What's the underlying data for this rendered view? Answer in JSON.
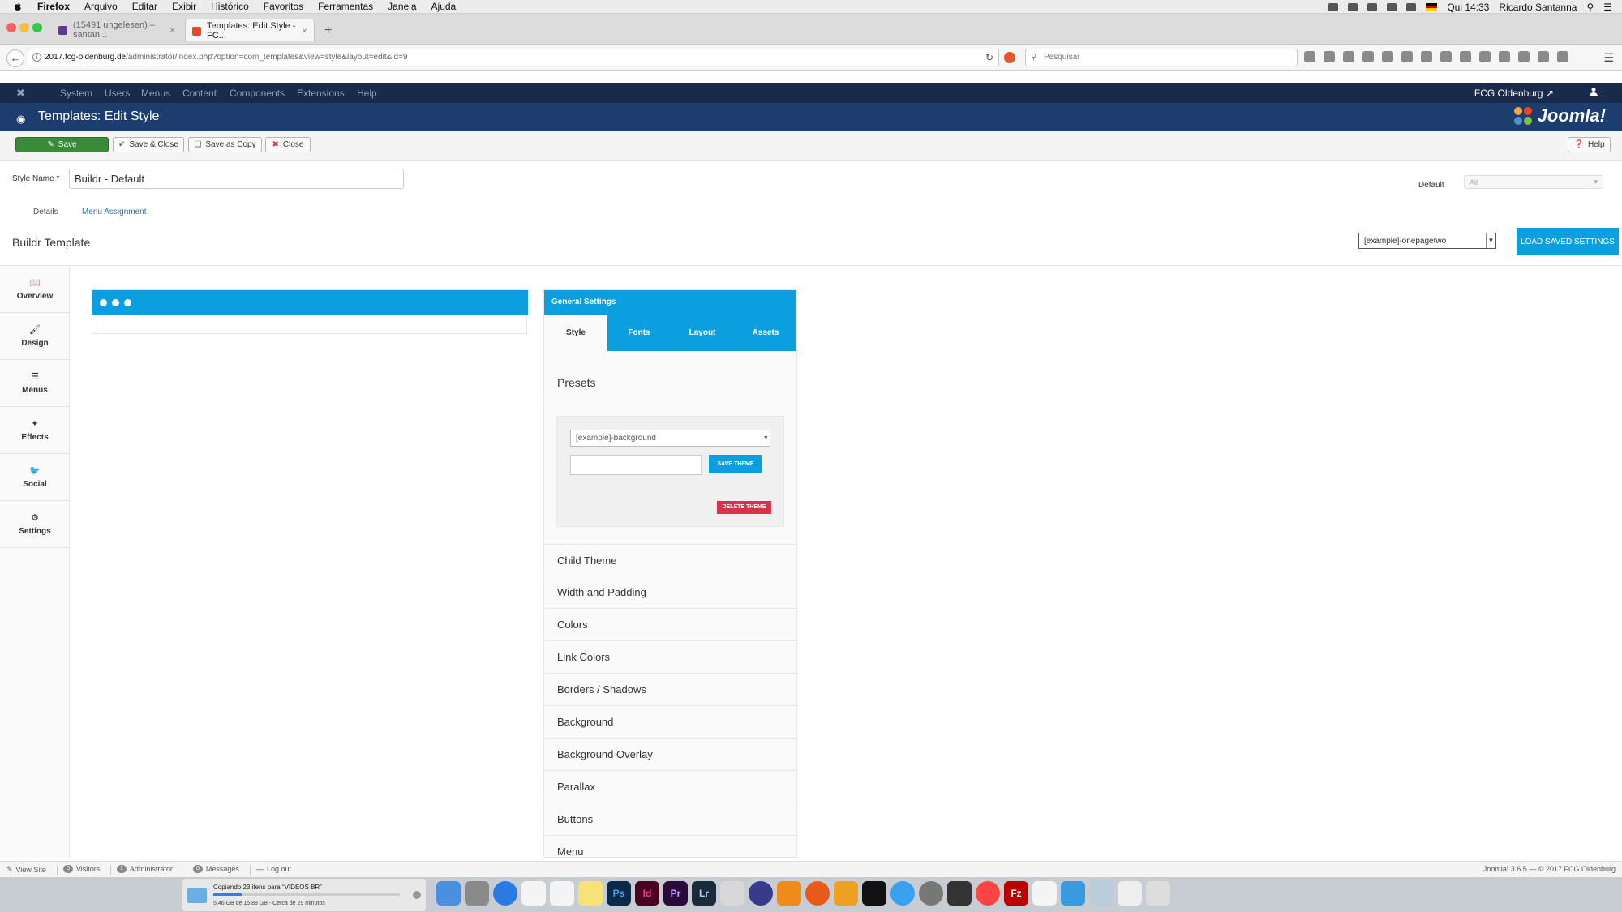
{
  "os_menubar": {
    "app": "Firefox",
    "menus": [
      "Arquivo",
      "Editar",
      "Exibir",
      "Histórico",
      "Favoritos",
      "Ferramentas",
      "Janela",
      "Ajuda"
    ],
    "clock": "Qui 14:33",
    "user": "Ricardo Santanna"
  },
  "browser": {
    "tabs": [
      {
        "label": "(15491 ungelesen) – santan...",
        "active": false
      },
      {
        "label": "Templates: Edit Style - FC...",
        "active": true
      }
    ],
    "url_host": "2017.fcg-oldenburg.de",
    "url_path": "/administrator/index.php?option=com_templates&view=style&layout=edit&id=9",
    "search_placeholder": "Pesquisar"
  },
  "joomla_nav": {
    "items": [
      "System",
      "Users",
      "Menus",
      "Content",
      "Components",
      "Extensions",
      "Help"
    ],
    "site_name": "FCG Oldenburg"
  },
  "joomla_header": {
    "title": "Templates: Edit Style",
    "brand": "Joomla!"
  },
  "toolbar": {
    "save": "Save",
    "save_close": "Save & Close",
    "save_copy": "Save as Copy",
    "close": "Close",
    "help": "Help"
  },
  "form": {
    "style_name_label": "Style Name *",
    "style_name_value": "Buildr - Default",
    "default_label": "Default",
    "default_value": "All",
    "tabs": [
      "Details",
      "Menu Assignment"
    ]
  },
  "builder": {
    "title": "Buildr Template",
    "saved_preset": "[example]-onepagetwo",
    "load_button": "LOAD SAVED SETTINGS",
    "sidebar": [
      {
        "label": "Overview",
        "icon": "book-icon"
      },
      {
        "label": "Design",
        "icon": "brush-icon"
      },
      {
        "label": "Menus",
        "icon": "menu-icon"
      },
      {
        "label": "Effects",
        "icon": "effects-icon"
      },
      {
        "label": "Social",
        "icon": "twitter-icon"
      },
      {
        "label": "Settings",
        "icon": "gear-icon"
      }
    ]
  },
  "settings_panel": {
    "header": "General Settings",
    "tabs": [
      "Style",
      "Fonts",
      "Layout",
      "Assets"
    ],
    "presets_title": "Presets",
    "preset_select": "[example]-background",
    "save_theme": "SAVE THEME",
    "delete_theme": "DELETE THEME",
    "sections": [
      "Child Theme",
      "Width and Padding",
      "Colors",
      "Link Colors",
      "Borders / Shadows",
      "Background",
      "Background Overlay",
      "Parallax",
      "Buttons",
      "Menu"
    ]
  },
  "status_bar": {
    "view_site": "View Site",
    "visitors_count": "0",
    "visitors": "Visitors",
    "admin_count": "1",
    "administrator": "Administrator",
    "messages_count": "0",
    "messages": "Messages",
    "logout": "Log out",
    "version": "Joomla! 3.6.5 — © 2017 FCG Oldenburg"
  },
  "dock": {
    "download_title": "Copiando 23 itens para “VIDEOS BR”",
    "download_progress": 0.15,
    "download_detail": "5,46 GB de 15,88 GB - Cerca de 29 minutos",
    "apps": [
      "Ps",
      "Id",
      "Pr",
      "Lr",
      "Fz"
    ]
  },
  "colors": {
    "accent": "#0c9fe0",
    "joomla_nav_bg": "#1a2a4a",
    "joomla_header_bg": "#1c3d6e",
    "save_green": "#3a8a3a",
    "delete_red": "#d9334a"
  }
}
